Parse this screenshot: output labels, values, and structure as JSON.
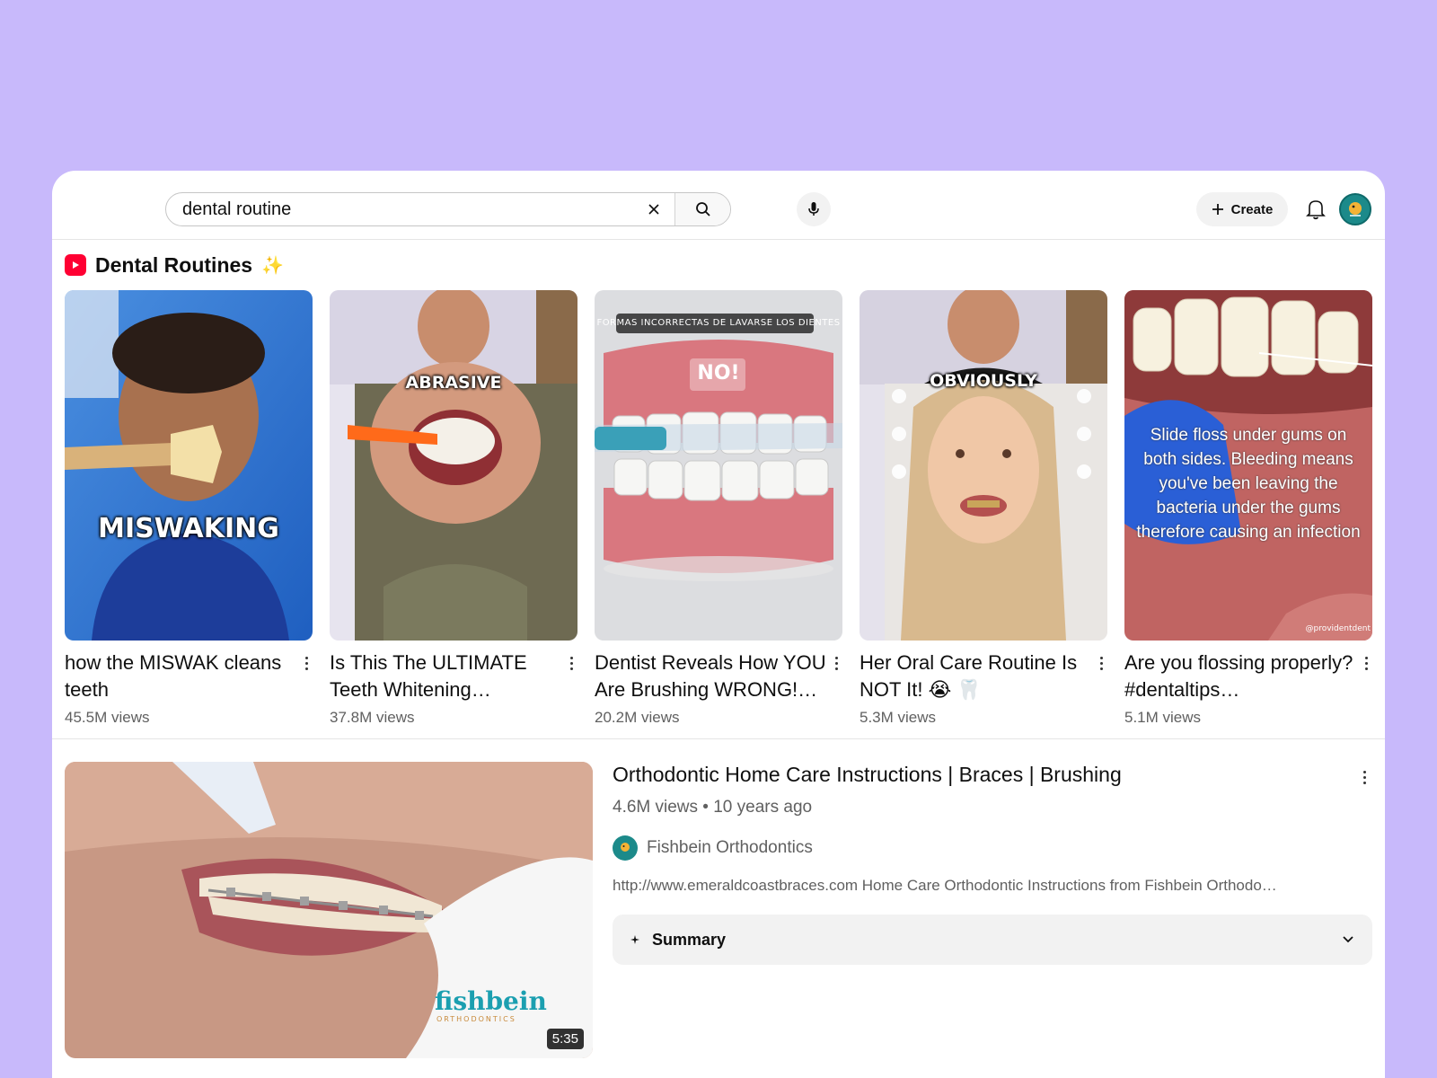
{
  "search": {
    "query": "dental routine"
  },
  "header": {
    "create_label": "Create"
  },
  "shelf": {
    "title": "Dental Routines",
    "shorts": [
      {
        "title": "how the MISWAK cleans teeth",
        "views": "45.5M views",
        "overlay": "MISWAKING"
      },
      {
        "title": "Is This The ULTIMATE Teeth Whitening…",
        "views": "37.8M views",
        "overlay": "ABRASIVE"
      },
      {
        "title": "Dentist Reveals How YOU Are Brushing WRONG!…",
        "views": "20.2M views",
        "overlay": "NO!",
        "caption": "FORMAS INCORRECTAS DE LAVARSE LOS DIENTES"
      },
      {
        "title": "Her Oral Care Routine Is NOT It! 😭 🦷",
        "views": "5.3M views",
        "overlay": "OBVIOUSLY"
      },
      {
        "title": "Are you flossing properly? #dentaltips…",
        "views": "5.1M views",
        "overlay": "Slide floss under gums on both sides. Bleeding means you've been leaving the bacteria under the gums therefore causing an infection",
        "watermark": "@providentdent"
      }
    ]
  },
  "video": {
    "title": "Orthodontic Home Care Instructions | Braces | Brushing",
    "meta": "4.6M views • 10 years ago",
    "channel": "Fishbein Orthodontics",
    "description": "http://www.emeraldcoastbraces.com Home Care Orthodontic Instructions from Fishbein Orthodo…",
    "duration": "5:35",
    "thumb_brand": "fishbein",
    "thumb_brand_sub": "ORTHODONTICS",
    "summary_label": "Summary"
  },
  "colors": {
    "background": "#c8b9fb",
    "shorts_red": "#ff0033",
    "channel_teal": "#1c8a8a"
  }
}
